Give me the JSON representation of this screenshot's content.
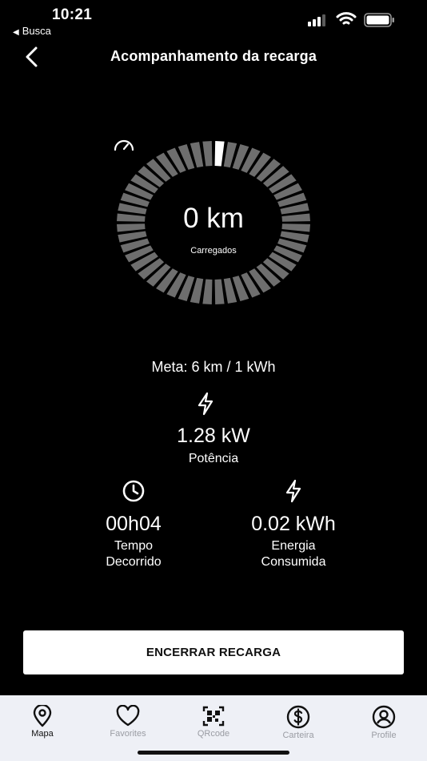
{
  "status_bar": {
    "time": "10:21",
    "back_app": "Busca"
  },
  "header": {
    "title": "Acompanhamento da recarga"
  },
  "gauge": {
    "value": "0 km",
    "label": "Carregados",
    "progress": 0,
    "segments": 48
  },
  "goal": {
    "text": "Meta: 6 km / 1 kWh"
  },
  "power": {
    "value": "1.28 kW",
    "label": "Potência"
  },
  "stats": {
    "elapsed": {
      "value": "00h04",
      "label_line1": "Tempo",
      "label_line2": "Decorrido"
    },
    "energy": {
      "value": "0.02 kWh",
      "label_line1": "Energia",
      "label_line2": "Consumida"
    }
  },
  "actions": {
    "end_label": "ENCERRAR RECARGA"
  },
  "tabs": [
    {
      "label": "Mapa",
      "icon": "map-pin-icon",
      "active": true
    },
    {
      "label": "Favorites",
      "icon": "heart-icon",
      "active": false
    },
    {
      "label": "QRcode",
      "icon": "qrcode-icon",
      "active": false
    },
    {
      "label": "Carteira",
      "icon": "dollar-icon",
      "active": false
    },
    {
      "label": "Profile",
      "icon": "user-icon",
      "active": false
    }
  ],
  "colors": {
    "background": "#000000",
    "segment": "#6e6e6e",
    "segment_active": "#ffffff",
    "tabbar": "#eef0f6"
  }
}
